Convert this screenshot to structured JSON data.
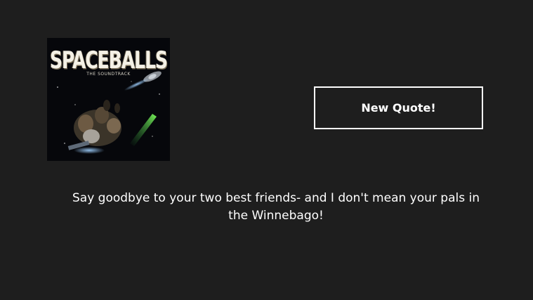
{
  "album": {
    "title": "SPACEBALLS",
    "subtitle": "THE SOUNDTRACK"
  },
  "actions": {
    "new_quote_label": "New Quote!"
  },
  "quote": {
    "text": "Say goodbye to your two best friends- and I don't mean your pals in the Winnebago!"
  },
  "colors": {
    "background": "#1e1e1e",
    "text": "#ffffff",
    "button_border": "#ffffff"
  }
}
